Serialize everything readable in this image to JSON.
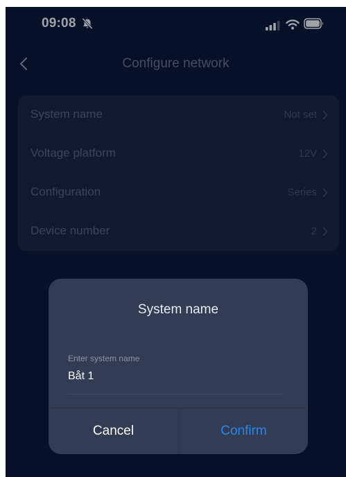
{
  "status_bar": {
    "time": "09:08",
    "icons": [
      "bell-slash-icon",
      "signal-icon",
      "wifi-icon",
      "battery-icon"
    ]
  },
  "nav": {
    "back_icon": "chevron-left-icon",
    "title": "Configure network"
  },
  "settings": {
    "rows": [
      {
        "label": "System name",
        "value": "Not set"
      },
      {
        "label": "Voltage platform",
        "value": "12V"
      },
      {
        "label": "Configuration",
        "value": "Series"
      },
      {
        "label": "Device number",
        "value": "2"
      }
    ]
  },
  "dialog": {
    "title": "System name",
    "field_label": "Enter system name",
    "field_value": "Båt 1",
    "cancel_label": "Cancel",
    "confirm_label": "Confirm"
  },
  "colors": {
    "background": "#081632",
    "card": "#1b2540",
    "dialog": "#323c52",
    "accent": "#2f84e6"
  }
}
